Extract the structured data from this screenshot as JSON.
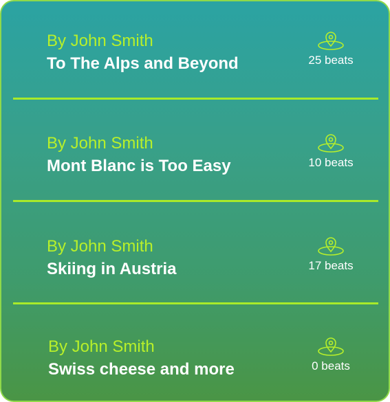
{
  "items": [
    {
      "author": "By John Smith",
      "title": "To The Alps and Beyond",
      "beats": "25 beats",
      "icon": "location-pin-icon"
    },
    {
      "author": "By John Smith",
      "title": "Mont Blanc is Too Easy",
      "beats": "10 beats",
      "icon": "location-pin-icon"
    },
    {
      "author": "By John Smith",
      "title": "Skiing in Austria",
      "beats": "17 beats",
      "icon": "location-pin-icon"
    },
    {
      "author": "By John Smith",
      "title": "Swiss cheese and more",
      "beats": "0 beats",
      "icon": "location-pin-icon"
    }
  ],
  "colors": {
    "accent": "#b8f02a",
    "divider": "#a8ea2a",
    "border": "#8fd94a",
    "gradient_top": "#2ba3a3",
    "gradient_bottom": "#4a9545"
  }
}
